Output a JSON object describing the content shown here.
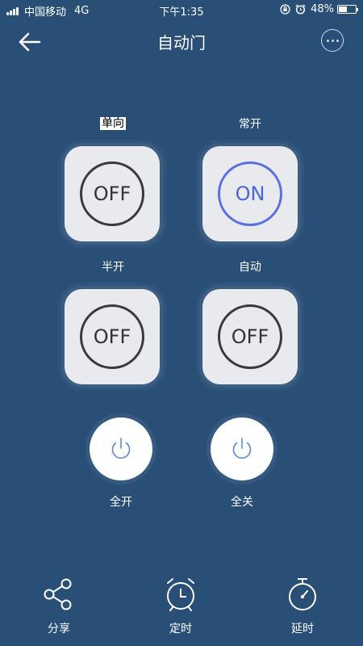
{
  "status_bar": {
    "carrier": "中国移动",
    "network": "4G",
    "time": "下午1:35",
    "battery": "48%",
    "battery_level": 0.48
  },
  "nav": {
    "title": "自动门"
  },
  "switches": [
    {
      "label": "单向",
      "state": "OFF"
    },
    {
      "label": "常开",
      "state": "ON"
    },
    {
      "label": "半开",
      "state": "OFF"
    },
    {
      "label": "自动",
      "state": "OFF"
    }
  ],
  "power_buttons": [
    {
      "label": "全开"
    },
    {
      "label": "全关"
    }
  ],
  "toolbar": [
    {
      "label": "分享",
      "icon": "share-icon"
    },
    {
      "label": "定时",
      "icon": "alarm-clock-icon"
    },
    {
      "label": "延时",
      "icon": "stopwatch-icon"
    }
  ],
  "colors": {
    "background": "#2a4f77",
    "tile": "#e8eaee",
    "on_accent": "#5b6fe0",
    "power_icon": "#5a86d8"
  }
}
